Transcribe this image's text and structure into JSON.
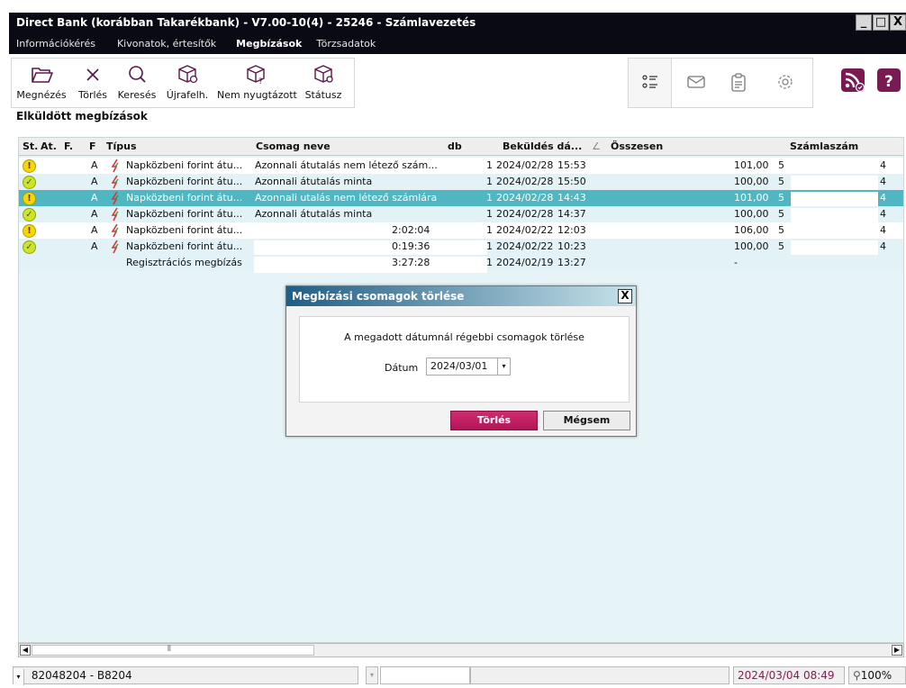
{
  "window": {
    "title": "Direct Bank (korábban Takarékbank) - V7.00-10(4) - 25246 - Számlavezetés",
    "min": "_",
    "max": "□",
    "close": "X"
  },
  "menu": [
    {
      "label": "Információkérés"
    },
    {
      "label": "Kivonatok, értesítők"
    },
    {
      "label": "Megbízások"
    },
    {
      "label": "Törzsadatok"
    }
  ],
  "toolbar": {
    "view": "Megnézés",
    "delete": "Törlés",
    "search": "Keresés",
    "resend": "Újrafelh.",
    "unacked": "Nem nyugtázott",
    "status": "Státusz"
  },
  "section_title": "Elküldött megbízások",
  "table": {
    "columns": {
      "st": "St.",
      "at": "At.",
      "f1": "F.",
      "f2": "F",
      "type": "Típus",
      "package": "Csomag neve",
      "db": "db",
      "sent": "Beküldés dá...",
      "sort_mark": "∠",
      "total": "Összesen",
      "account": "Számlaszám"
    },
    "rows": [
      {
        "status": "!",
        "f": "A",
        "type": "Napközbeni forint átu...",
        "package": "Azonnali átutalás nem létező szám...",
        "db": "1",
        "date": "2024/02/28",
        "time": "15:53",
        "total": "101,00",
        "acc": "5",
        "acc_end": "4"
      },
      {
        "status": "✓",
        "f": "A",
        "type": "Napközbeni forint átu...",
        "package": "Azonnali átutalás minta",
        "db": "1",
        "date": "2024/02/28",
        "time": "15:50",
        "total": "100,00",
        "acc": "5",
        "acc_end": "4"
      },
      {
        "status": "!",
        "f": "A",
        "type": "Napközbeni forint átu...",
        "package": "Azonnali utalás nem létező számlára",
        "db": "1",
        "date": "2024/02/28",
        "time": "14:43",
        "total": "101,00",
        "acc": "5",
        "acc_end": "4"
      },
      {
        "status": "✓",
        "f": "A",
        "type": "Napközbeni forint átu...",
        "package": "Azonnali átutalás minta",
        "db": "1",
        "date": "2024/02/28",
        "time": "14:37",
        "total": "100,00",
        "acc": "5",
        "acc_end": "4"
      },
      {
        "status": "!",
        "f": "A",
        "type": "Napközbeni forint átu...",
        "package": "2:02:04",
        "db": "1",
        "date": "2024/02/22",
        "time": "12:03",
        "total": "106,00",
        "acc": "5",
        "acc_end": "4"
      },
      {
        "status": "✓",
        "f": "A",
        "type": "Napközbeni forint átu...",
        "package": "0:19:36",
        "db": "1",
        "date": "2024/02/22",
        "time": "10:23",
        "total": "100,00",
        "acc": "5",
        "acc_end": "4"
      },
      {
        "status": "",
        "f": "",
        "type": "Regisztrációs megbízás",
        "package": "3:27:28",
        "db": "1",
        "date": "2024/02/19",
        "time": "13:27",
        "total": "-",
        "acc": "",
        "acc_end": ""
      }
    ]
  },
  "scroll": {
    "left": "◀",
    "right": "▶",
    "grip": "⫴"
  },
  "statusbar": {
    "account": "82048204 - B8204",
    "datetime": "2024/03/04 08:49",
    "zoom": "100%"
  },
  "dialog": {
    "title": "Megbízási csomagok törlése",
    "close": "X",
    "message": "A megadott dátumnál régebbi csomagok törlése",
    "date_label": "Dátum",
    "date_value": "2024/03/01",
    "delete_button": "Törlés",
    "cancel_button": "Mégsem"
  },
  "colors": {
    "accent": "#4fb6c2",
    "brand_primary": "#b01758",
    "rss": "#7a1a52"
  }
}
